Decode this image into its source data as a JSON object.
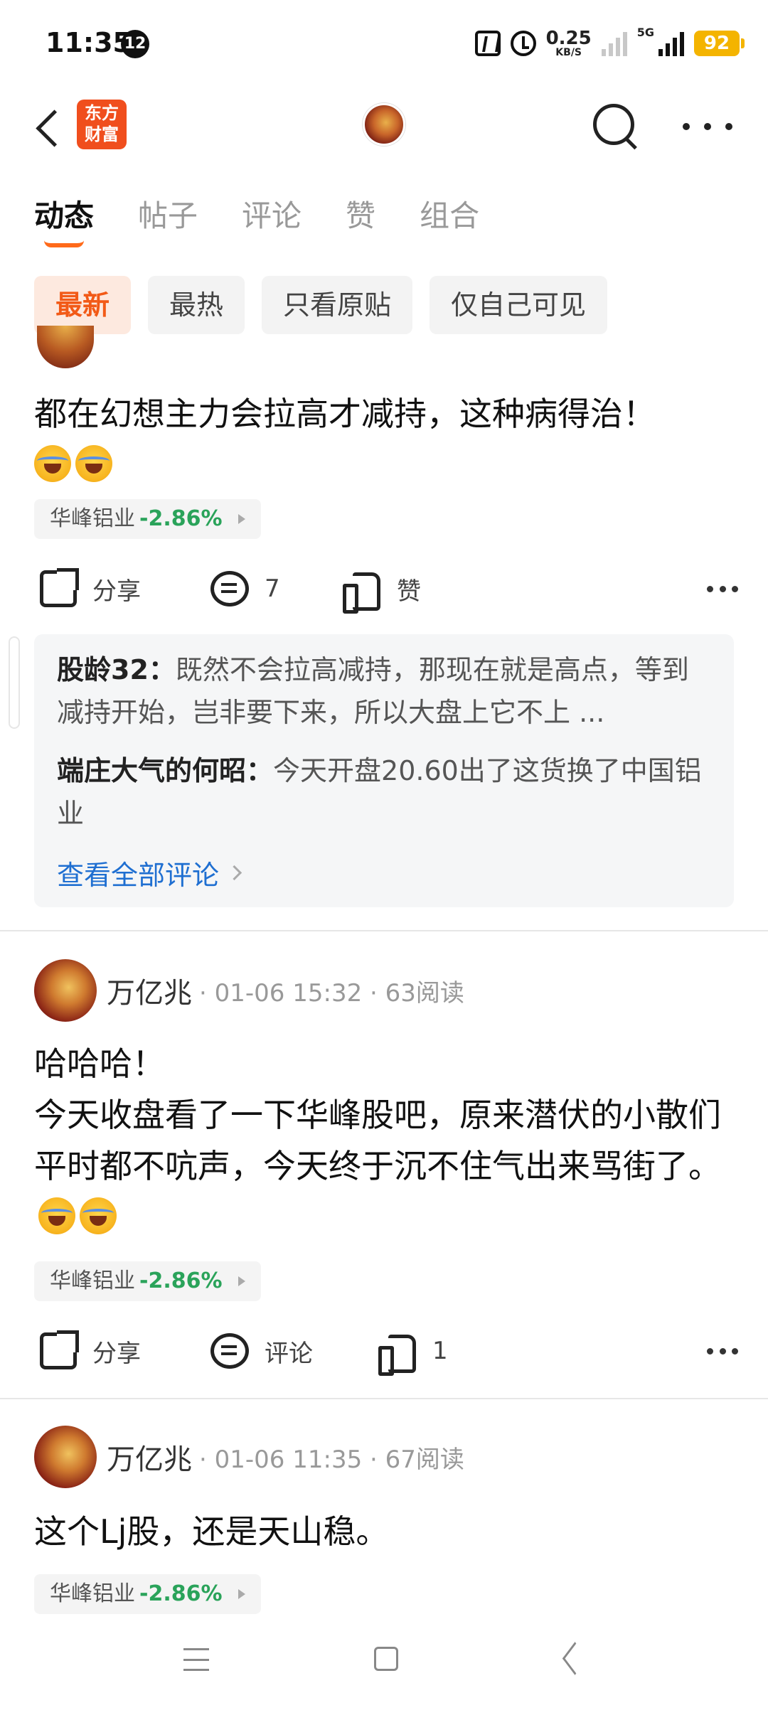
{
  "status_bar": {
    "time": "11:35",
    "notif_count": "12",
    "net_speed": "0.25",
    "net_unit": "KB/S",
    "network": "5G",
    "battery": "92"
  },
  "header": {
    "logo_text": "东方财富"
  },
  "tabs": [
    {
      "label": "动态",
      "active": true
    },
    {
      "label": "帖子",
      "active": false
    },
    {
      "label": "评论",
      "active": false
    },
    {
      "label": "赞",
      "active": false
    },
    {
      "label": "组合",
      "active": false
    }
  ],
  "filters": [
    {
      "label": "最新",
      "active": true
    },
    {
      "label": "最热",
      "active": false
    },
    {
      "label": "只看原贴",
      "active": false
    },
    {
      "label": "仅自己可见",
      "active": false
    }
  ],
  "posts": [
    {
      "text": "都在幻想主力会拉高才减持，这种病得治！",
      "stock_name": "华峰铝业",
      "stock_change": "-2.86%",
      "share_label": "分享",
      "comment_label": "7",
      "like_label": "赞",
      "comments": [
        {
          "author": "股龄32：",
          "text": "既然不会拉高减持，那现在就是高点，等到减持开始，岂非要下来，所以大盘上它不上 ..."
        },
        {
          "author": "端庄大气的何昭：",
          "text": "今天开盘20.60出了这货换了中国铝业"
        }
      ],
      "see_all": "查看全部评论"
    },
    {
      "author": "万亿兆",
      "meta": "· 01-06 15:32 · 63阅读",
      "text_line1": "哈哈哈！",
      "text_line2": "今天收盘看了一下华峰股吧，原来潜伏的小散们平时都不吭声，今天终于沉不住气出来骂街了。",
      "stock_name": "华峰铝业",
      "stock_change": "-2.86%",
      "share_label": "分享",
      "comment_label": "评论",
      "like_label": "1"
    },
    {
      "author": "万亿兆",
      "meta": "· 01-06 11:35 · 67阅读",
      "text": "这个Lj股，还是天山稳。",
      "stock_name": "华峰铝业",
      "stock_change": "-2.86%"
    }
  ]
}
